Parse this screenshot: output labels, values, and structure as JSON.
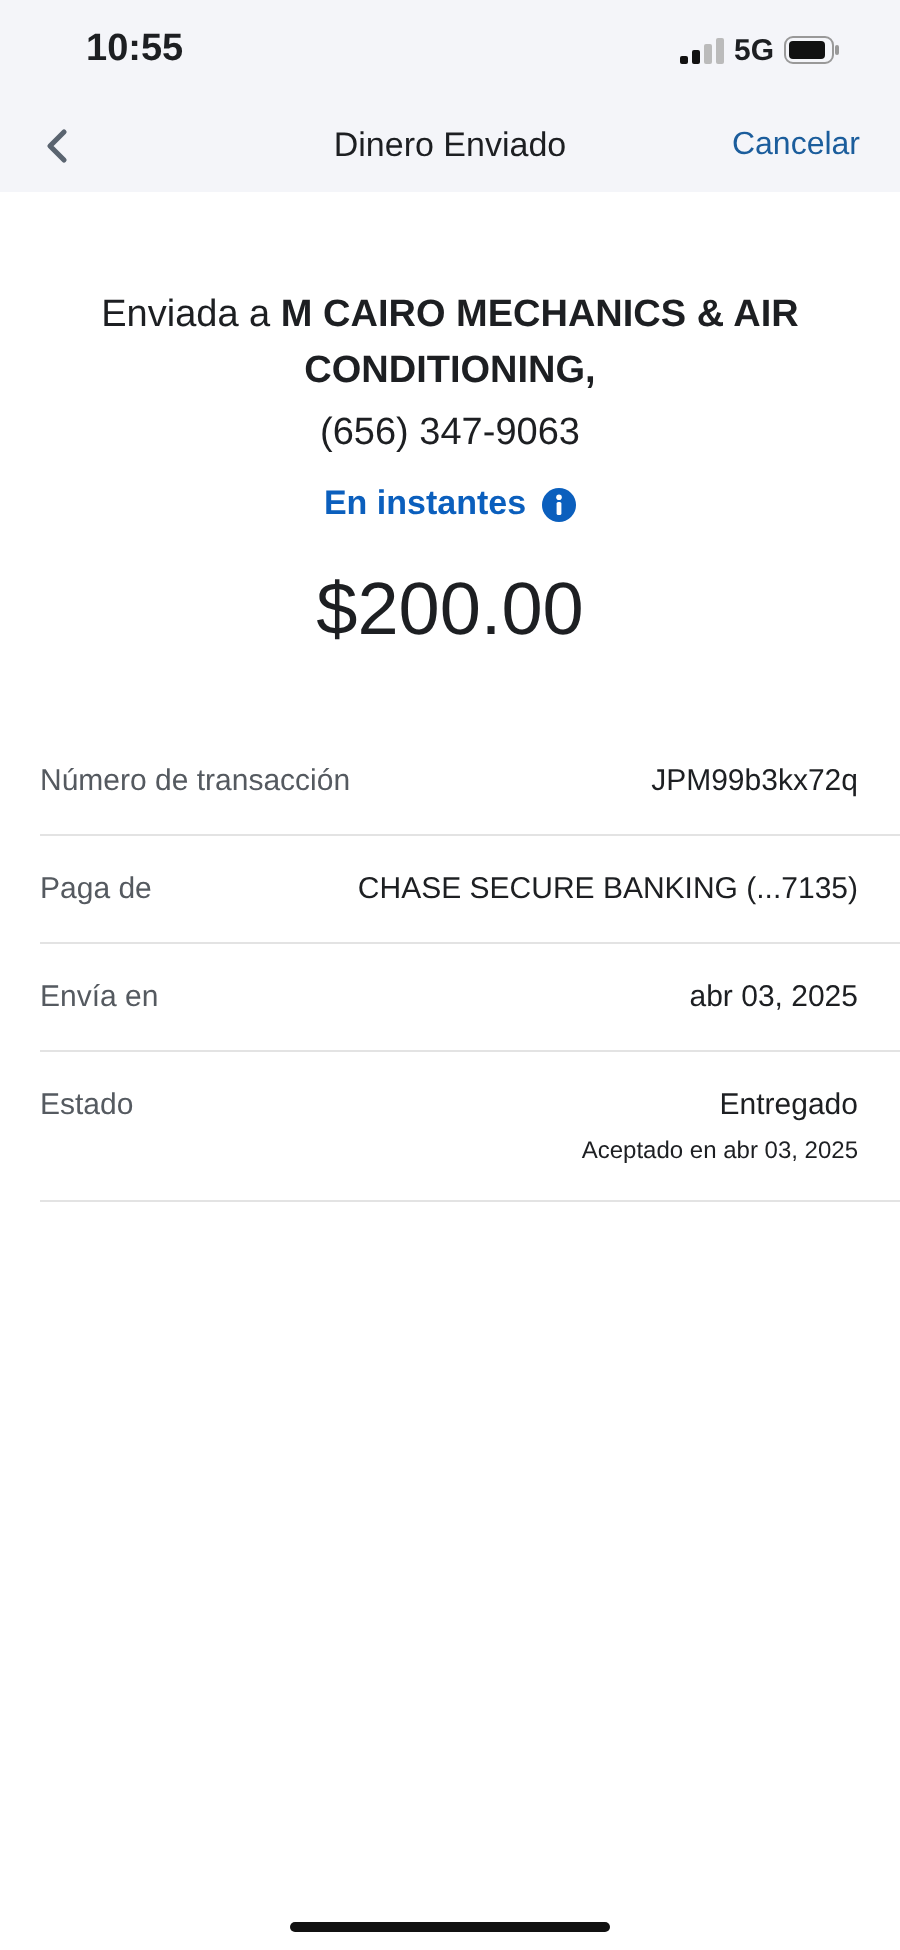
{
  "status_bar": {
    "time": "10:55",
    "network": "5G"
  },
  "nav": {
    "title": "Dinero Enviado",
    "cancel": "Cancelar"
  },
  "summary": {
    "recipient": "Enviada a **M CAIRO MECHANICS & AIR CONDITIONING,**",
    "phone": "(656) 347-9063",
    "speed": "En instantes",
    "amount": "$200.00"
  },
  "details": [
    {
      "label": "Número de transacción",
      "value": "JPM99b3kx72q"
    },
    {
      "label": "Paga de",
      "value": "CHASE SECURE BANKING (...7135)"
    },
    {
      "label": "Envía en",
      "value": "abr 03, 2025"
    },
    {
      "label": "Estado",
      "value": "Entregado",
      "note": "Aceptado en abr 03, 2025"
    }
  ]
}
